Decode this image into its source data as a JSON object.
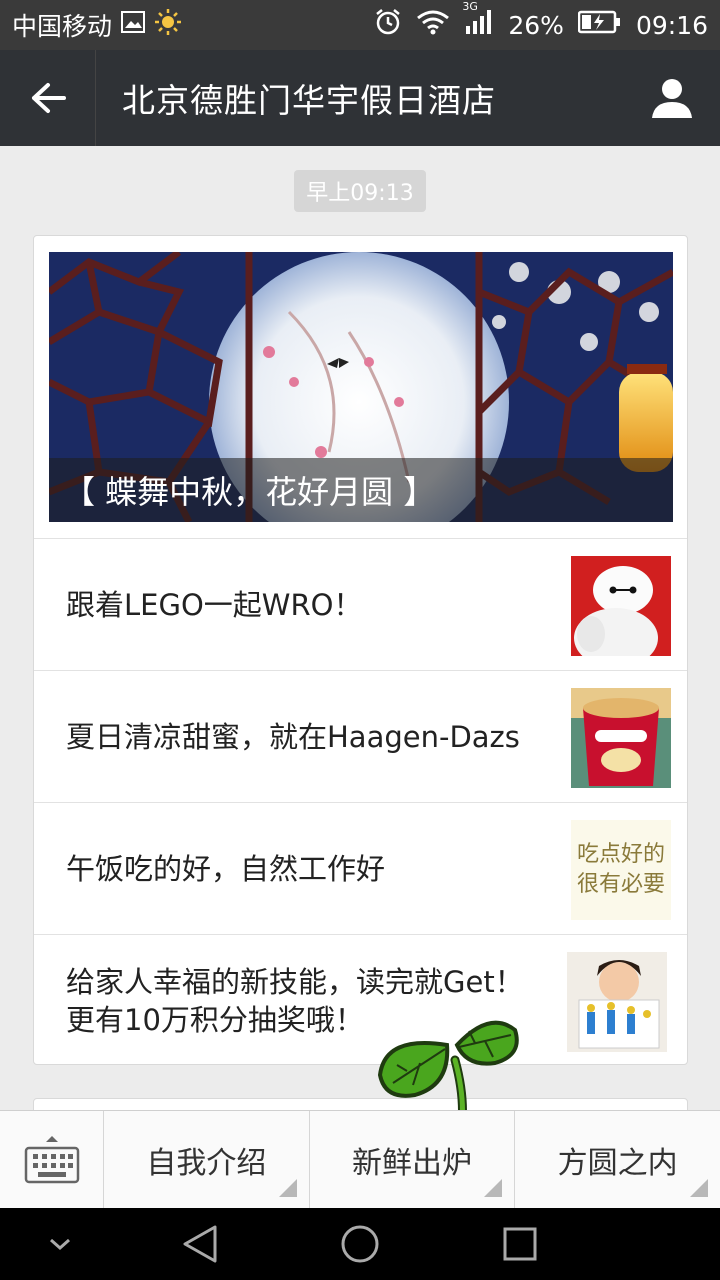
{
  "status": {
    "carrier": "中国移动",
    "network": "3G",
    "battery": "26%",
    "time": "09:16"
  },
  "header": {
    "title": "北京德胜门华宇假日酒店"
  },
  "timestamp": "早上09:13",
  "cover": {
    "caption": "【 蝶舞中秋，花好月圆 】"
  },
  "articles": [
    {
      "title": "跟着LEGO一起WRO！"
    },
    {
      "title": "夏日清凉甜蜜，就在Haagen-Dazs"
    },
    {
      "title": "午饭吃的好，自然工作好",
      "thumb_text": [
        "吃点好的",
        "很有必要"
      ]
    },
    {
      "title": "给家人幸福的新技能，读完就Get！更有10万积分抽奖哦！"
    }
  ],
  "menu": {
    "items": [
      "自我介绍",
      "新鲜出炉",
      "方圆之内"
    ]
  },
  "colors": {
    "header_bg": "#2f3236",
    "status_bg": "#3a3a3a",
    "page_bg": "#ececec"
  }
}
